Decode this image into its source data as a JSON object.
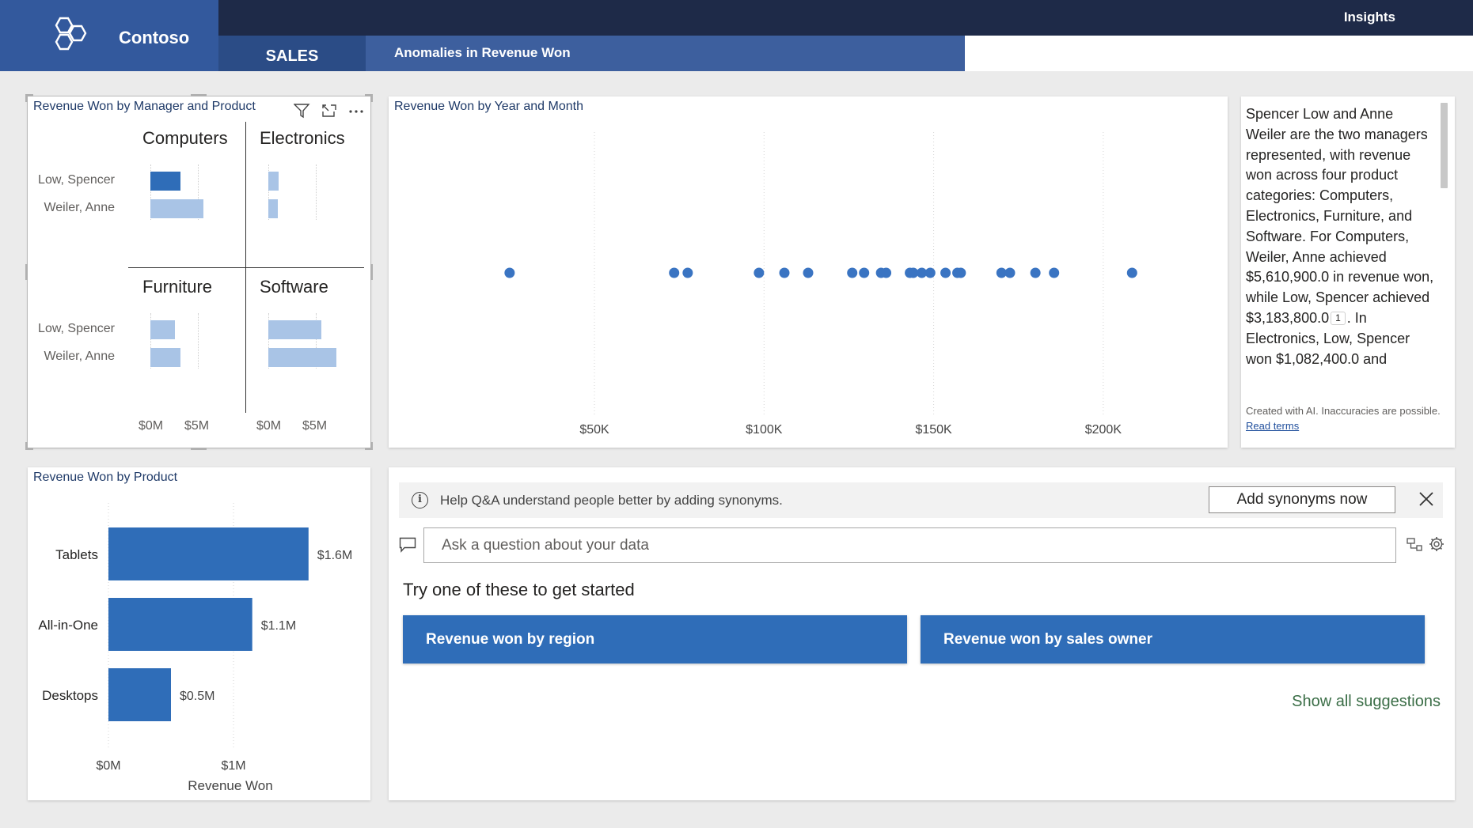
{
  "app": {
    "brand": "Contoso",
    "insights_link": "Insights",
    "tabs": [
      {
        "label": "SALES"
      },
      {
        "label": "Anomalies in Revenue Won"
      }
    ]
  },
  "colors": {
    "header_dark": "#1e2a48",
    "logo_block": "#33599d",
    "tab_active": "#2b4c86",
    "tab_page": "#3d5f9e",
    "bar_primary": "#2f6db8",
    "bar_light": "#a9c4e6",
    "dot": "#3a74c2",
    "suggestion_button": "#2f6db8",
    "link_green": "#3b6e47"
  },
  "visuals": {
    "matrix": {
      "title": "Revenue Won by Manager and Product",
      "tools": [
        "filter-icon",
        "focus-mode-icon",
        "more-options-icon"
      ],
      "panels": [
        {
          "title": "Computers",
          "rows": [
            {
              "label": "Low, Spencer",
              "value": 3.18,
              "highlight": true
            },
            {
              "label": "Weiler, Anne",
              "value": 5.61,
              "highlight": false
            }
          ]
        },
        {
          "title": "Electronics",
          "rows": [
            {
              "label": "Low, Spencer",
              "value": 1.08,
              "highlight": false
            },
            {
              "label": "Weiler, Anne",
              "value": 1.0,
              "highlight": false
            }
          ]
        },
        {
          "title": "Furniture",
          "rows": [
            {
              "label": "Low, Spencer",
              "value": 2.6,
              "highlight": false
            },
            {
              "label": "Weiler, Anne",
              "value": 3.2,
              "highlight": false
            }
          ]
        },
        {
          "title": "Software",
          "rows": [
            {
              "label": "Low, Spencer",
              "value": 5.6,
              "highlight": false
            },
            {
              "label": "Weiler, Anne",
              "value": 7.2,
              "highlight": false
            }
          ]
        }
      ],
      "x_ticks": [
        "$0M",
        "$5M"
      ]
    },
    "narrative": {
      "parts": [
        "Spencer Low and Anne Weiler are the two managers represented, with revenue won across four product categories: Computers, Electronics, Furniture, and Software. For Computers, Weiler, Anne achieved $5,610,900.0 in revenue won, while Low, Spencer achieved $3,183,800.0",
        "1",
        ". In Electronics, Low, Spencer won $1,082,400.0 and"
      ],
      "footer": "Created with AI. Inaccuracies are possible.",
      "footer_link": "Read terms"
    },
    "qa": {
      "banner_text": "Help Q&A understand people better by adding synonyms.",
      "add_synonyms_label": "Add synonyms now",
      "input_placeholder": "Ask a question about your data",
      "try_title": "Try one of these to get started",
      "suggestions": [
        "Revenue won by region",
        "Revenue won by sales owner"
      ],
      "show_all": "Show all suggestions"
    }
  },
  "chart_data": [
    {
      "type": "scatter",
      "title": "Revenue Won by Year and Month",
      "x_ticks": [
        50000,
        100000,
        150000,
        200000
      ],
      "x_tick_labels": [
        "$50K",
        "$100K",
        "$150K",
        "$200K"
      ],
      "xlim": [
        8000,
        218000
      ],
      "x": [
        25000,
        73500,
        77500,
        98500,
        106000,
        113000,
        126000,
        129500,
        134500,
        136000,
        143000,
        144000,
        146500,
        149000,
        153500,
        157000,
        158000,
        170000,
        172500,
        180000,
        185500,
        208500
      ],
      "grid": true
    },
    {
      "type": "bar",
      "orientation": "horizontal",
      "title": "Revenue Won by Product",
      "xlabel": "Revenue Won",
      "categories": [
        "Tablets",
        "All-in-One",
        "Desktops"
      ],
      "values": [
        1.6,
        1.15,
        0.5
      ],
      "data_labels": [
        "$1.6M",
        "$1.1M",
        "$0.5M"
      ],
      "x_ticks": [
        0,
        1
      ],
      "x_tick_labels": [
        "$0M",
        "$1M"
      ],
      "xlim": [
        0,
        1.6
      ]
    }
  ]
}
